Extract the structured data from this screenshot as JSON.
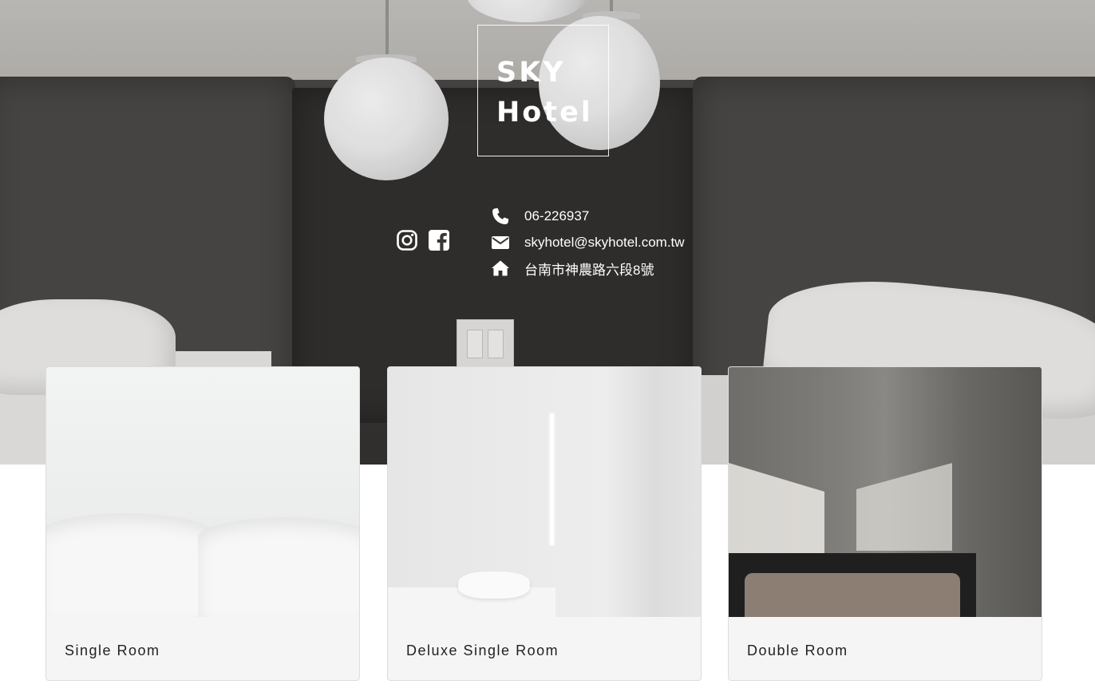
{
  "hotel": {
    "name_line1": "SKY",
    "name_line2": "Hotel"
  },
  "social": {
    "icons": [
      "instagram-icon",
      "facebook-icon"
    ]
  },
  "contact": {
    "phone": "06-226937",
    "email": "skyhotel@skyhotel.com.tw",
    "address": "台南市神農路六段8號"
  },
  "rooms": [
    {
      "title": "Single Room"
    },
    {
      "title": "Deluxe Single Room"
    },
    {
      "title": "Double Room"
    }
  ],
  "colors": {
    "hero_text": "#ffffff",
    "card_bg": "#f5f5f5",
    "card_title": "#222222"
  }
}
